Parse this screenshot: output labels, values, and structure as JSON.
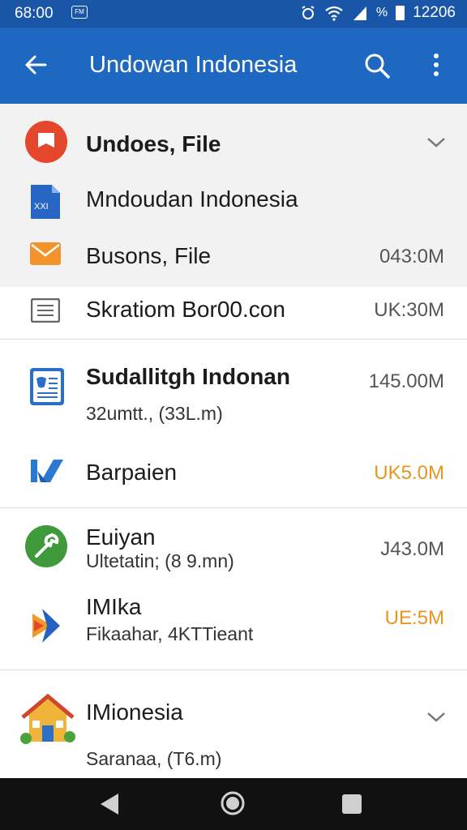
{
  "status_bar": {
    "time": "68:00",
    "notif_label": "FM",
    "battery_text": "%",
    "clock": "12206"
  },
  "app_bar": {
    "title": "Undowan Indonesia"
  },
  "sections": [
    {
      "title": "Undoes, File",
      "items": [
        {
          "label": "Mndoudan Indonesia",
          "size": ""
        },
        {
          "label": "Busons, File",
          "size": "043:0M"
        },
        {
          "label": "Skratiom Bor00.con",
          "size": "UK:30M"
        }
      ]
    },
    {
      "items": [
        {
          "label": "Sudallitgh Indonan",
          "sub": "32umtt., (33L.m)",
          "size": "145.00M"
        },
        {
          "label": "Barpaien",
          "size": "UK5.0M"
        }
      ]
    },
    {
      "items": [
        {
          "label": "Euiyan",
          "sub": "Ultetatin; (8 9.mn)",
          "size": "J43.0M"
        },
        {
          "label": "IMIka",
          "sub": "Fikaahar, 4KTTieant",
          "size": "UE:5M"
        }
      ]
    },
    {
      "title": "IMionesia",
      "sub": "Saranaa, (T6.m)"
    }
  ],
  "colors": {
    "appbar": "#1f68c1",
    "statusbar": "#1a56a8",
    "accent_size": "#e8951f"
  }
}
